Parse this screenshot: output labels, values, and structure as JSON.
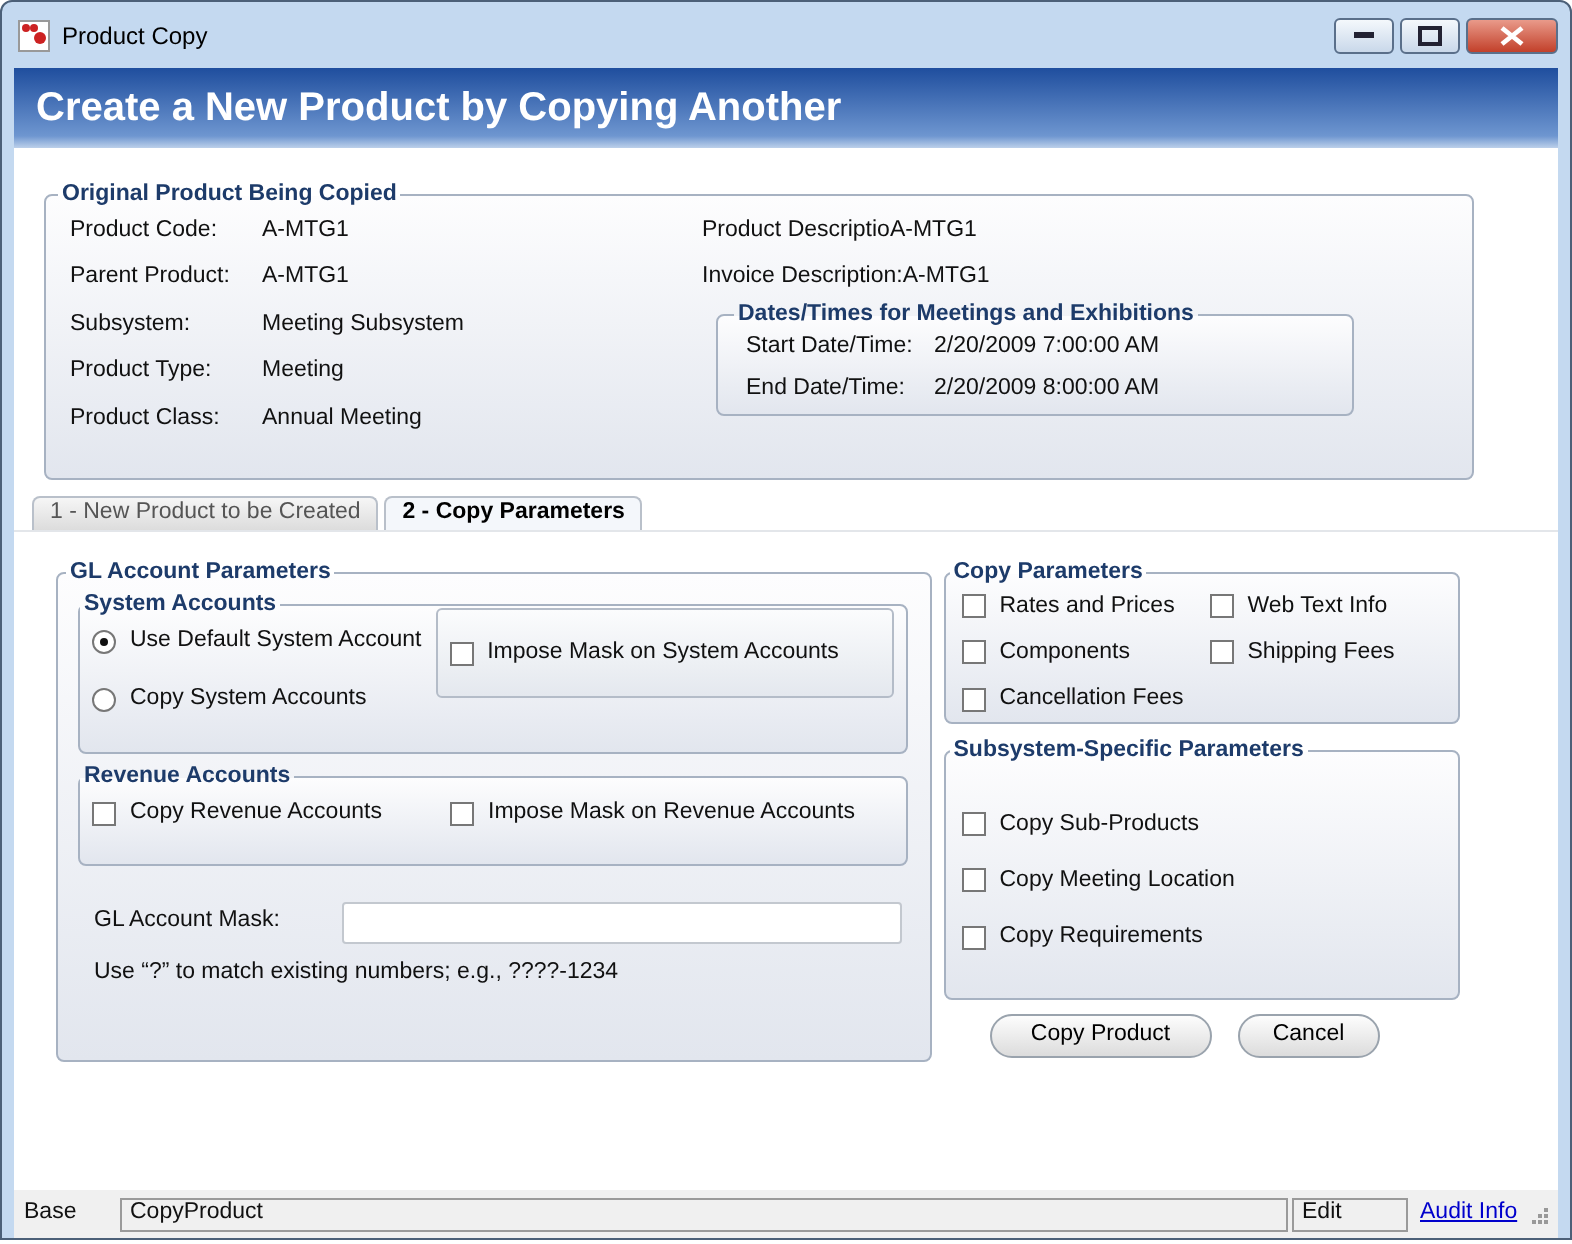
{
  "window": {
    "title": "Product Copy"
  },
  "header": {
    "title": "Create a New Product by Copying Another"
  },
  "original_product": {
    "title": "Original Product Being Copied",
    "fields": [
      {
        "label": "Product Code:",
        "value": "A-MTG1"
      },
      {
        "label": "Parent Product:",
        "value": "A-MTG1"
      },
      {
        "label": "Subsystem:",
        "value": "Meeting Subsystem"
      },
      {
        "label": "Product Type:",
        "value": "Meeting"
      },
      {
        "label": "Product Class:",
        "value": "Annual Meeting"
      }
    ],
    "descriptions": [
      {
        "label": "Product Descriptio",
        "value": "A-MTG1"
      },
      {
        "label": "Invoice Description:",
        "value": "A-MTG1"
      }
    ],
    "dates": {
      "title": "Dates/Times for Meetings and Exhibitions",
      "fields": [
        {
          "label": "Start Date/Time:",
          "value": "2/20/2009 7:00:00 AM"
        },
        {
          "label": "End Date/Time:",
          "value": "2/20/2009 8:00:00 AM"
        }
      ]
    }
  },
  "tabs": [
    {
      "label": "1 - New Product to be Created",
      "selected": false
    },
    {
      "label": "2 - Copy Parameters",
      "selected": true
    }
  ],
  "gl_account_parameters": {
    "title": "GL Account Parameters",
    "system_accounts": {
      "title": "System Accounts",
      "options": [
        {
          "label": "Use Default System Account",
          "selected": true
        },
        {
          "label": "Copy System Accounts",
          "selected": false
        }
      ],
      "impose_mask": {
        "label": "Impose Mask on System Accounts",
        "checked": false
      }
    },
    "revenue_accounts": {
      "title": "Revenue Accounts",
      "options": [
        {
          "label": "Copy Revenue Accounts",
          "checked": false
        },
        {
          "label": "Impose Mask on Revenue Accounts",
          "checked": false
        }
      ]
    },
    "mask_field": {
      "label": "GL Account Mask:"
    },
    "hint": "Use “?” to match existing numbers; e.g., ????-1234"
  },
  "copy_parameters": {
    "title": "Copy Parameters",
    "options": [
      {
        "label": "Rates and Prices",
        "checked": false
      },
      {
        "label": "Web Text Info",
        "checked": false
      },
      {
        "label": "Components",
        "checked": false
      },
      {
        "label": "Shipping Fees",
        "checked": false
      },
      {
        "label": "Cancellation Fees",
        "checked": false
      }
    ]
  },
  "subsystem_parameters": {
    "title": "Subsystem-Specific Parameters",
    "options": [
      {
        "label": "Copy Sub-Products",
        "checked": false
      },
      {
        "label": "Copy Meeting Location",
        "checked": false
      },
      {
        "label": "Copy Requirements",
        "checked": false
      }
    ]
  },
  "buttons": [
    {
      "label": "Copy Product"
    },
    {
      "label": "Cancel"
    }
  ],
  "status_bar": {
    "mode": "Base",
    "command": "CopyProduct",
    "state": "Edit",
    "link": "Audit Info"
  }
}
